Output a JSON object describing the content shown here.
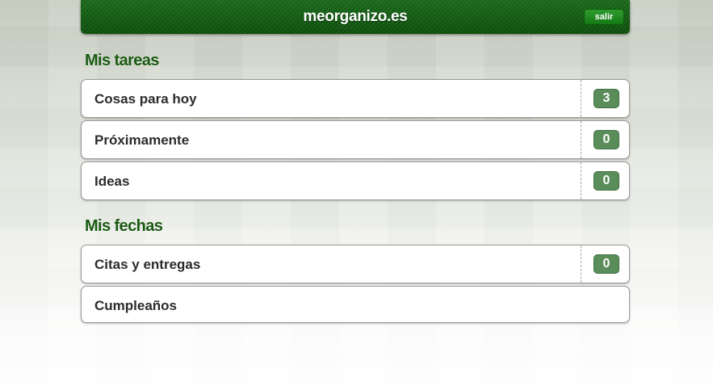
{
  "header": {
    "brand": "meorganizo.es",
    "logout_label": "salir"
  },
  "sections": [
    {
      "title": "Mis tareas",
      "items": [
        {
          "label": "Cosas para hoy",
          "count": "3"
        },
        {
          "label": "Próximamente",
          "count": "0"
        },
        {
          "label": "Ideas",
          "count": "0"
        }
      ]
    },
    {
      "title": "Mis fechas",
      "items": [
        {
          "label": "Citas y entregas",
          "count": "0"
        },
        {
          "label": "Cumpleaños"
        }
      ]
    }
  ],
  "colors": {
    "header_green": "#0c4f0c",
    "title_green": "#1a5a12",
    "badge_green": "#5b8d5b"
  }
}
